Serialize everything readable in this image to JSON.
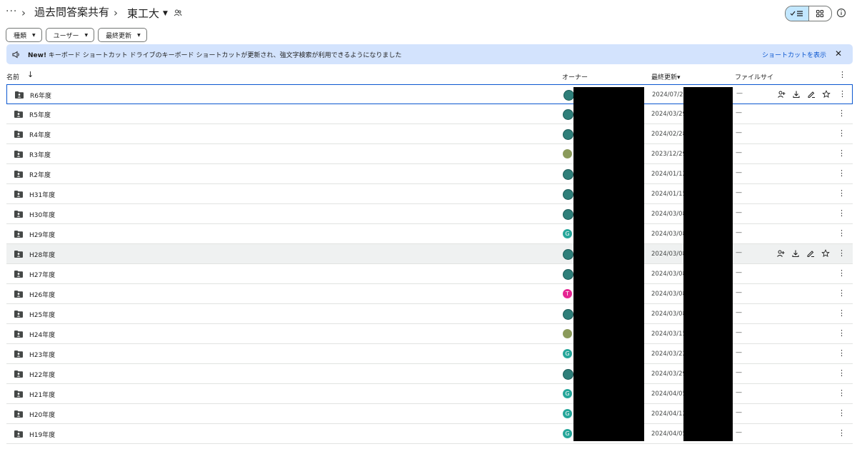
{
  "breadcrumb": {
    "more": "···",
    "separator": "›",
    "parent": "過去問答案共有",
    "current": "東工大"
  },
  "filters": [
    {
      "label": "種類"
    },
    {
      "label": "ユーザー"
    },
    {
      "label": "最終更新"
    }
  ],
  "banner": {
    "badge": "New!",
    "message": " キーボード ショートカット ドライブのキーボード ショートカットが更新され、強文字検索が利用できるようになりました",
    "link": "ショートカットを表示",
    "close": "✕"
  },
  "columns": {
    "name": "名前",
    "sort_arrow": "↓",
    "owner": "オーナー",
    "modified": "最終更新",
    "modified_caret": "▾",
    "size": "ファイルサイ",
    "more": "⋮"
  },
  "colors": {
    "teal": "#26a69a",
    "pink": "#e52592",
    "selection": "#0b57d0",
    "banner": "#d3e3fd"
  },
  "rows": [
    {
      "name": "R6年度",
      "date": "2024/07/25",
      "size": "—",
      "kebab": "⋮"
    },
    {
      "name": "R5年度",
      "date": "2024/03/29",
      "size": "—",
      "kebab": "⋮"
    },
    {
      "name": "R4年度",
      "date": "2024/02/28",
      "size": "—",
      "kebab": "⋮"
    },
    {
      "name": "R3年度",
      "date": "2023/12/29",
      "size": "—",
      "kebab": "⋮"
    },
    {
      "name": "R2年度",
      "date": "2024/01/12",
      "size": "—",
      "kebab": "⋮"
    },
    {
      "name": "H31年度",
      "date": "2024/01/15",
      "size": "—",
      "kebab": "⋮"
    },
    {
      "name": "H30年度",
      "date": "2024/03/08",
      "size": "—",
      "kebab": "⋮"
    },
    {
      "name": "H29年度",
      "date": "2024/03/08",
      "size": "—",
      "kebab": "⋮",
      "avatar_letter": "G"
    },
    {
      "name": "H28年度",
      "date": "2024/03/08",
      "size": "—",
      "kebab": "⋮"
    },
    {
      "name": "H27年度",
      "date": "2024/03/08",
      "size": "—",
      "kebab": "⋮"
    },
    {
      "name": "H26年度",
      "date": "2024/03/08",
      "size": "—",
      "kebab": "⋮",
      "avatar_letter": "T"
    },
    {
      "name": "H25年度",
      "date": "2024/03/08",
      "size": "—",
      "kebab": "⋮"
    },
    {
      "name": "H24年度",
      "date": "2024/03/15",
      "size": "—",
      "kebab": "⋮"
    },
    {
      "name": "H23年度",
      "date": "2024/03/22",
      "size": "—",
      "kebab": "⋮",
      "avatar_letter": "G"
    },
    {
      "name": "H22年度",
      "date": "2024/03/29",
      "size": "—",
      "kebab": "⋮"
    },
    {
      "name": "H21年度",
      "date": "2024/04/05",
      "size": "—",
      "kebab": "⋮",
      "avatar_letter": "G"
    },
    {
      "name": "H20年度",
      "date": "2024/04/12",
      "size": "—",
      "kebab": "⋮",
      "avatar_letter": "G"
    },
    {
      "name": "H19年度",
      "date": "2024/04/05",
      "size": "—",
      "kebab": "⋮",
      "avatar_letter": "G"
    }
  ]
}
